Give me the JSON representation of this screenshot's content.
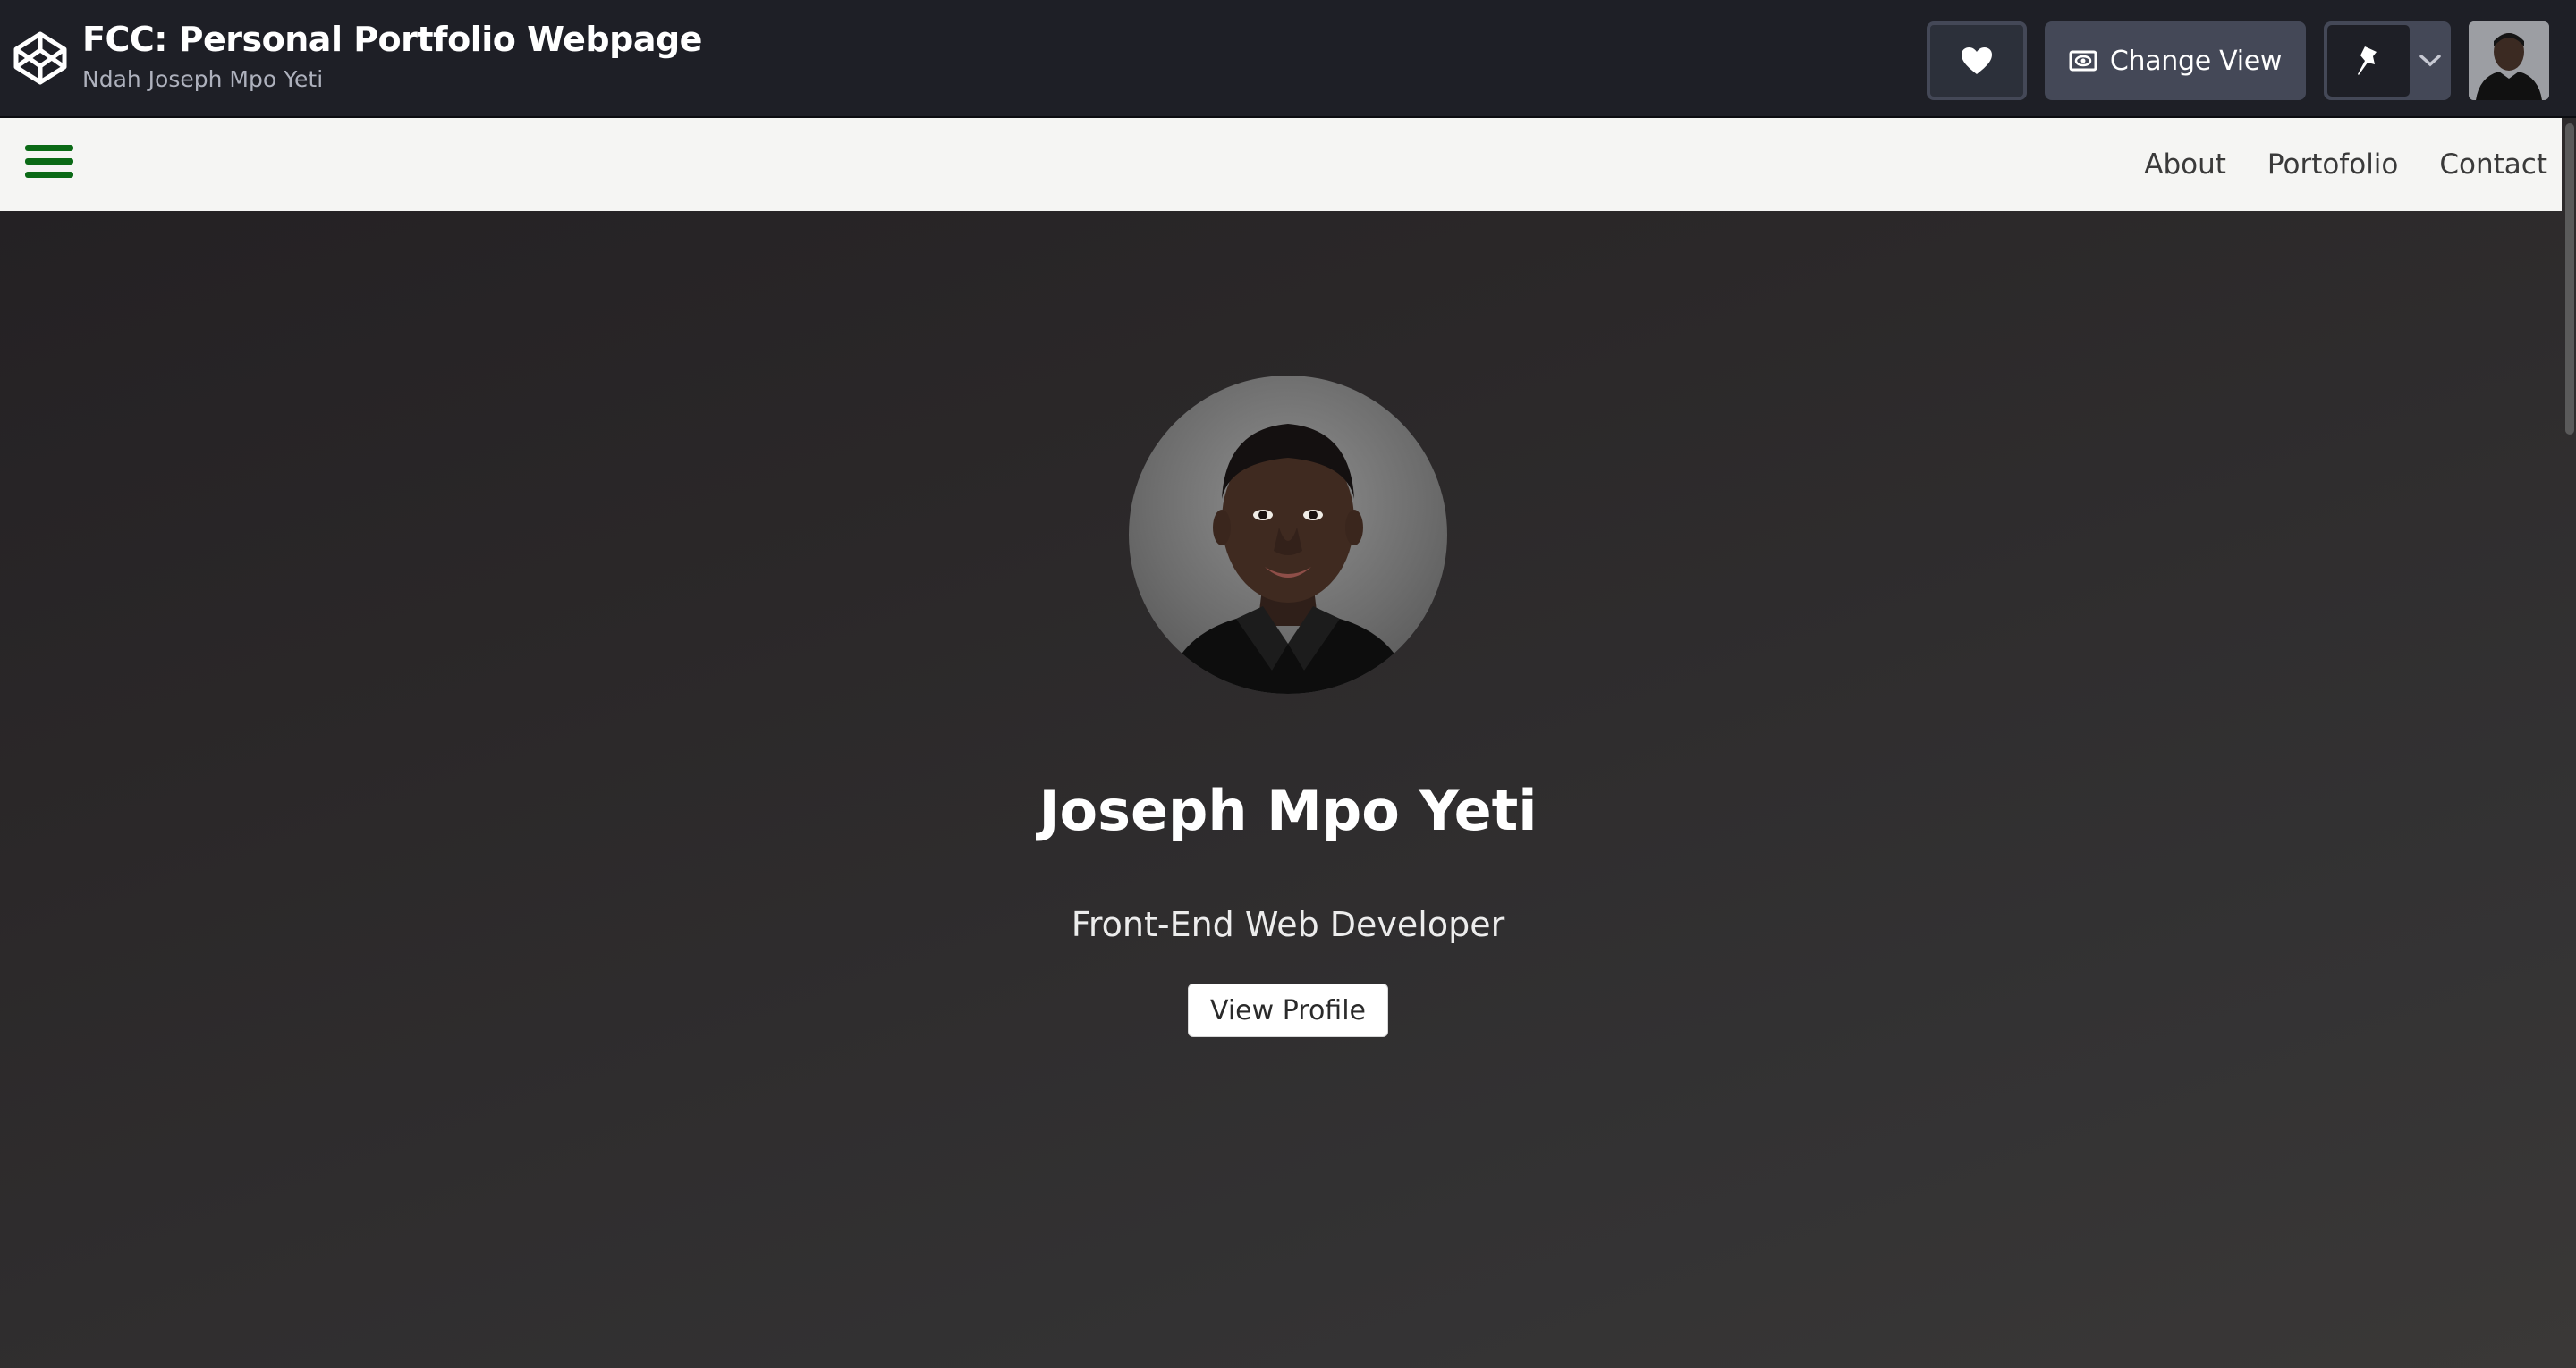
{
  "codepen": {
    "title": "FCC: Personal Portfolio Webpage",
    "author": "Ndah Joseph Mpo Yeti",
    "change_view_label": "Change View"
  },
  "site": {
    "nav": [
      {
        "label": "About"
      },
      {
        "label": "Portofolio"
      },
      {
        "label": "Contact"
      }
    ],
    "hero": {
      "name": "Joseph Mpo Yeti",
      "role": "Front-End Web Developer",
      "button_label": "View Profile"
    }
  },
  "colors": {
    "topbar_bg": "#1e1f26",
    "button_bg": "#444857",
    "nav_bg": "#f5f5f3",
    "hamburger": "#0b6a16",
    "hero_bg": "#2b2829"
  },
  "icons": {
    "logo": "codepen-logo-icon",
    "like": "heart-icon",
    "change_view": "eye-window-icon",
    "pin": "pin-icon",
    "pin_menu": "chevron-down-icon",
    "menu": "hamburger-menu-icon"
  }
}
